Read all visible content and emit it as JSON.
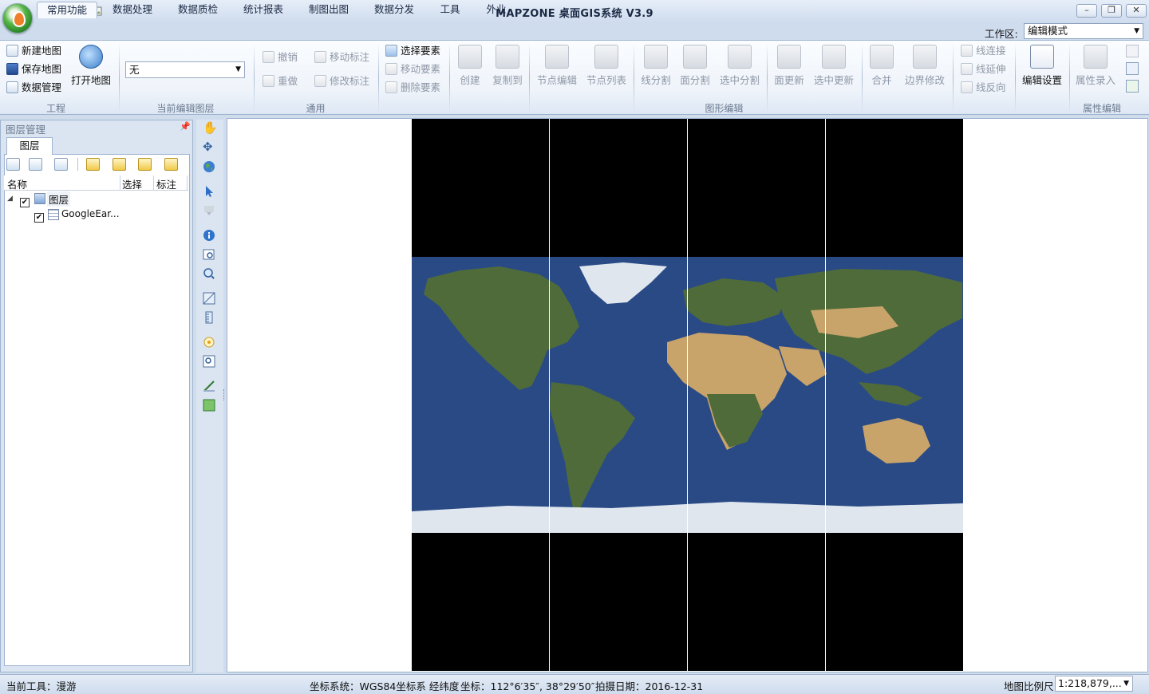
{
  "window": {
    "title": "MAPZONE 桌面GIS系统 V3.9",
    "minimize": "–",
    "restore": "❐",
    "close": "✕"
  },
  "tabs": [
    "常用功能",
    "数据处理",
    "数据质检",
    "统计报表",
    "制图出图",
    "数据分发",
    "工具",
    "外业"
  ],
  "workspace": {
    "label": "工作区:",
    "value": "编辑模式"
  },
  "ribbon": {
    "project": {
      "new_map": "新建地图",
      "save_map": "保存地图",
      "data_manage": "数据管理",
      "open_map": "打开地图",
      "group": "工程"
    },
    "edit_layer": {
      "value": "无",
      "group": "当前编辑图层"
    },
    "common": {
      "undo": "撤销",
      "redo": "重做",
      "move_label": "移动标注",
      "edit_label": "修改标注",
      "group": "通用"
    },
    "graphic": {
      "select": "选择要素",
      "move": "移动要素",
      "delete": "删除要素",
      "create": "创建",
      "copy_to": "复制到",
      "node_edit": "节点编辑",
      "node_list": "节点列表",
      "line_split": "线分割",
      "polygon_split": "面分割",
      "selected_split": "选中分割",
      "polygon_update": "面更新",
      "selected_update": "选中更新",
      "merge": "合并",
      "boundary_modify": "边界修改",
      "line_connect": "线连接",
      "line_extend": "线延伸",
      "line_reverse": "线反向",
      "edit_settings": "编辑设置",
      "group": "图形编辑"
    },
    "attribute": {
      "entry": "属性录入",
      "group": "属性编辑"
    }
  },
  "layer_panel": {
    "title": "图层管理",
    "tab": "图层",
    "columns": [
      "名称",
      "选择",
      "标注"
    ],
    "root": "图层",
    "layers": [
      "GoogleEar..."
    ]
  },
  "status": {
    "tool": "当前工具：漫游",
    "coord_system": "坐标系统：WGS84坐标系 经纬度",
    "coords": "坐标：112°6′35″, 38°29′50″",
    "capture_date": "拍摄日期：2016-12-31",
    "scale_label": "地图比例尺",
    "scale_value": "1:218,879,..."
  },
  "colors": {
    "accent": "#cfdcee",
    "ocean": "#2a4a86",
    "land": "#4f6b3a",
    "desert": "#c9a46a",
    "ice": "#dfe6ee"
  }
}
